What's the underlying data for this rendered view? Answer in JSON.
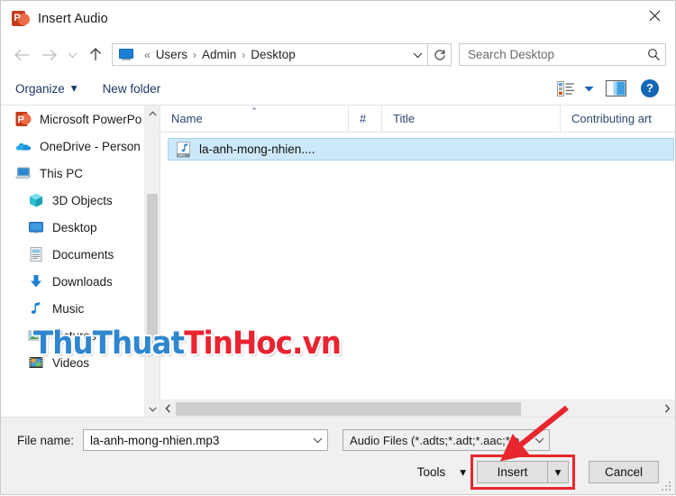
{
  "window": {
    "title": "Insert Audio",
    "app_icon": "powerpoint-icon",
    "close_label": "✕"
  },
  "navbar": {
    "back_icon": "back-arrow-icon",
    "forward_icon": "forward-arrow-icon",
    "recent_icon": "chevron-down-icon",
    "up_icon": "up-arrow-icon",
    "address_icon": "desktop-icon",
    "breadcrumbs": [
      "«",
      "Users",
      "Admin",
      "Desktop"
    ],
    "separator": "›",
    "dropdown_icon": "chevron-down-icon",
    "refresh_icon": "refresh-icon",
    "search_placeholder": "Search Desktop",
    "search_value": "",
    "search_icon": "search-icon"
  },
  "commandbar": {
    "organize_label": "Organize",
    "new_folder_label": "New folder",
    "caret": "▾",
    "view_icon": "view-list-icon",
    "view_caret_icon": "chevron-down-icon",
    "preview_pane_icon": "preview-pane-icon",
    "help_icon": "help-icon",
    "help_label": "?"
  },
  "sidebar": {
    "items": [
      {
        "label": "Microsoft PowerPo",
        "icon": "powerpoint-icon",
        "indent": false
      },
      {
        "label": "OneDrive - Person",
        "icon": "onedrive-cloud-icon",
        "indent": false
      },
      {
        "label": "This PC",
        "icon": "this-pc-icon",
        "indent": false
      },
      {
        "label": "3D Objects",
        "icon": "3d-objects-icon",
        "indent": true
      },
      {
        "label": "Desktop",
        "icon": "desktop-icon",
        "indent": true
      },
      {
        "label": "Documents",
        "icon": "documents-icon",
        "indent": true
      },
      {
        "label": "Downloads",
        "icon": "downloads-icon",
        "indent": true
      },
      {
        "label": "Music",
        "icon": "music-note-icon",
        "indent": true
      },
      {
        "label": "Pictures",
        "icon": "pictures-icon",
        "indent": true
      },
      {
        "label": "Videos",
        "icon": "videos-icon",
        "indent": true
      }
    ],
    "scroll_up_icon": "chevron-up-icon",
    "scroll_down_icon": "chevron-down-icon"
  },
  "filelist": {
    "columns": [
      {
        "label": "Name",
        "sorted": true,
        "sort_caret": "⌃"
      },
      {
        "label": "#",
        "sorted": false
      },
      {
        "label": "Title",
        "sorted": false
      },
      {
        "label": "Contributing art",
        "sorted": false
      }
    ],
    "rows": [
      {
        "name": "la-anh-mong-nhien....",
        "icon": "mp3-file-icon",
        "selected": true
      }
    ],
    "hscroll_left_icon": "chevron-left-icon",
    "hscroll_right_icon": "chevron-right-icon"
  },
  "footer": {
    "filename_label": "File name:",
    "filename_value": "la-anh-mong-nhien.mp3",
    "filename_dropdown_icon": "chevron-down-icon",
    "filter_value": "Audio Files (*.adts;*.adt;*.aac;*.a",
    "filter_dropdown_icon": "chevron-down-icon",
    "tools_label": "Tools",
    "tools_caret": "▾",
    "insert_label": "Insert",
    "insert_dropdown_caret": "▾",
    "cancel_label": "Cancel"
  },
  "annotations": {
    "highlight_color": "#e8262d",
    "arrow_color": "#e8262d",
    "watermark_part1": "ThuThuat",
    "watermark_part2": "TinHoc.vn",
    "watermark_color1": "#2f86cf",
    "watermark_color2": "#ea2330"
  }
}
